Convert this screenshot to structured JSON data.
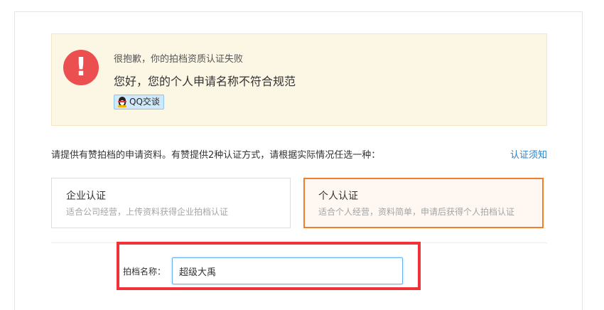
{
  "alert": {
    "title": "很抱歉，你的拍档资质认证失败",
    "message": "您好，您的个人申请名称不符合规范",
    "qq_button_label": "QQ交谈",
    "icon": "exclamation-icon",
    "icon_color": "#ec4f4f",
    "background_color": "#fcf6e5"
  },
  "intro": {
    "text": "请提供有赞拍档的申请资料。有赞提供2种认证方式，请根据实际情况任选一种：",
    "guide_link": "认证须知"
  },
  "options": [
    {
      "title": "企业认证",
      "description": "适合公司经营，上传资料获得企业拍档认证",
      "selected": false
    },
    {
      "title": "个人认证",
      "description": "适合个人经营，资料简单，申请后获得个人拍档认证",
      "selected": true
    }
  ],
  "form": {
    "name_label": "拍档名称：",
    "name_value": "超级大禹"
  },
  "colors": {
    "link": "#2f7fc1",
    "selected_border": "#f07e2a",
    "highlight_frame": "#ee3238",
    "input_focus": "#66aff0"
  }
}
